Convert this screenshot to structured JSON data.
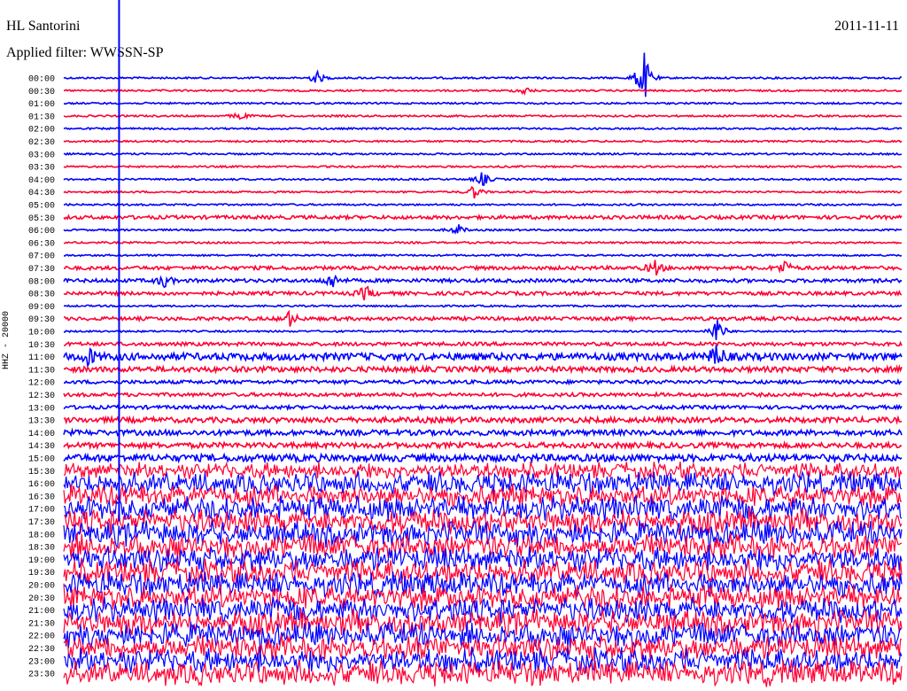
{
  "header": {
    "station": "HL Santorini",
    "filter": "Applied filter: WWSSN-SP",
    "date": "2011-11-11"
  },
  "colors": {
    "odd_trace": "#0000ff",
    "even_trace": "#ff0033"
  },
  "chart_data": {
    "type": "line",
    "title": "HL Santorini",
    "subtitle": "Applied filter: WWSSN-SP",
    "date": "2011-11-11",
    "ylabel": "HHZ - 20000",
    "grid": false,
    "legend": "none",
    "row_interval_minutes": 30,
    "row_labels": [
      "00:00",
      "00:30",
      "01:00",
      "01:30",
      "02:00",
      "02:30",
      "03:00",
      "03:30",
      "04:00",
      "04:30",
      "05:00",
      "05:30",
      "06:00",
      "06:30",
      "07:00",
      "07:30",
      "08:00",
      "08:30",
      "09:00",
      "09:30",
      "10:00",
      "10:30",
      "11:00",
      "11:30",
      "12:00",
      "12:30",
      "13:00",
      "13:30",
      "14:00",
      "14:30",
      "15:00",
      "15:30",
      "16:00",
      "16:30",
      "17:00",
      "17:30",
      "18:00",
      "18:30",
      "19:00",
      "19:30",
      "20:00",
      "20:30",
      "21:00",
      "21:30",
      "22:00",
      "22:30",
      "23:00",
      "23:30"
    ],
    "noise_level": [
      1,
      1,
      1,
      1,
      1,
      1,
      1,
      1,
      1,
      1,
      1,
      2,
      1,
      1,
      1,
      2,
      2,
      2,
      1,
      2,
      1,
      2,
      4,
      3,
      2,
      2,
      2,
      3,
      3,
      3,
      4,
      6,
      8,
      8,
      9,
      9,
      9,
      9,
      9,
      9,
      9,
      9,
      9,
      9,
      9,
      9,
      9,
      9
    ],
    "events": [
      {
        "row": 0,
        "pos": 0.302,
        "amp": 8
      },
      {
        "row": 0,
        "pos": 0.692,
        "amp": 35
      },
      {
        "row": 1,
        "pos": 0.55,
        "amp": 5
      },
      {
        "row": 3,
        "pos": 0.21,
        "amp": 5
      },
      {
        "row": 8,
        "pos": 0.5,
        "amp": 9
      },
      {
        "row": 9,
        "pos": 0.49,
        "amp": 8
      },
      {
        "row": 12,
        "pos": 0.47,
        "amp": 7
      },
      {
        "row": 15,
        "pos": 0.705,
        "amp": 10
      },
      {
        "row": 15,
        "pos": 0.86,
        "amp": 9
      },
      {
        "row": 16,
        "pos": 0.32,
        "amp": 10
      },
      {
        "row": 16,
        "pos": 0.12,
        "amp": 8
      },
      {
        "row": 17,
        "pos": 0.36,
        "amp": 9
      },
      {
        "row": 19,
        "pos": 0.27,
        "amp": 9
      },
      {
        "row": 20,
        "pos": 0.78,
        "amp": 18
      },
      {
        "row": 22,
        "pos": 0.03,
        "amp": 10
      },
      {
        "row": 22,
        "pos": 0.78,
        "amp": 16
      }
    ],
    "vertical_spikes": [
      {
        "x_frac": 0.066,
        "from_row": 0,
        "to_row": 35
      }
    ]
  }
}
